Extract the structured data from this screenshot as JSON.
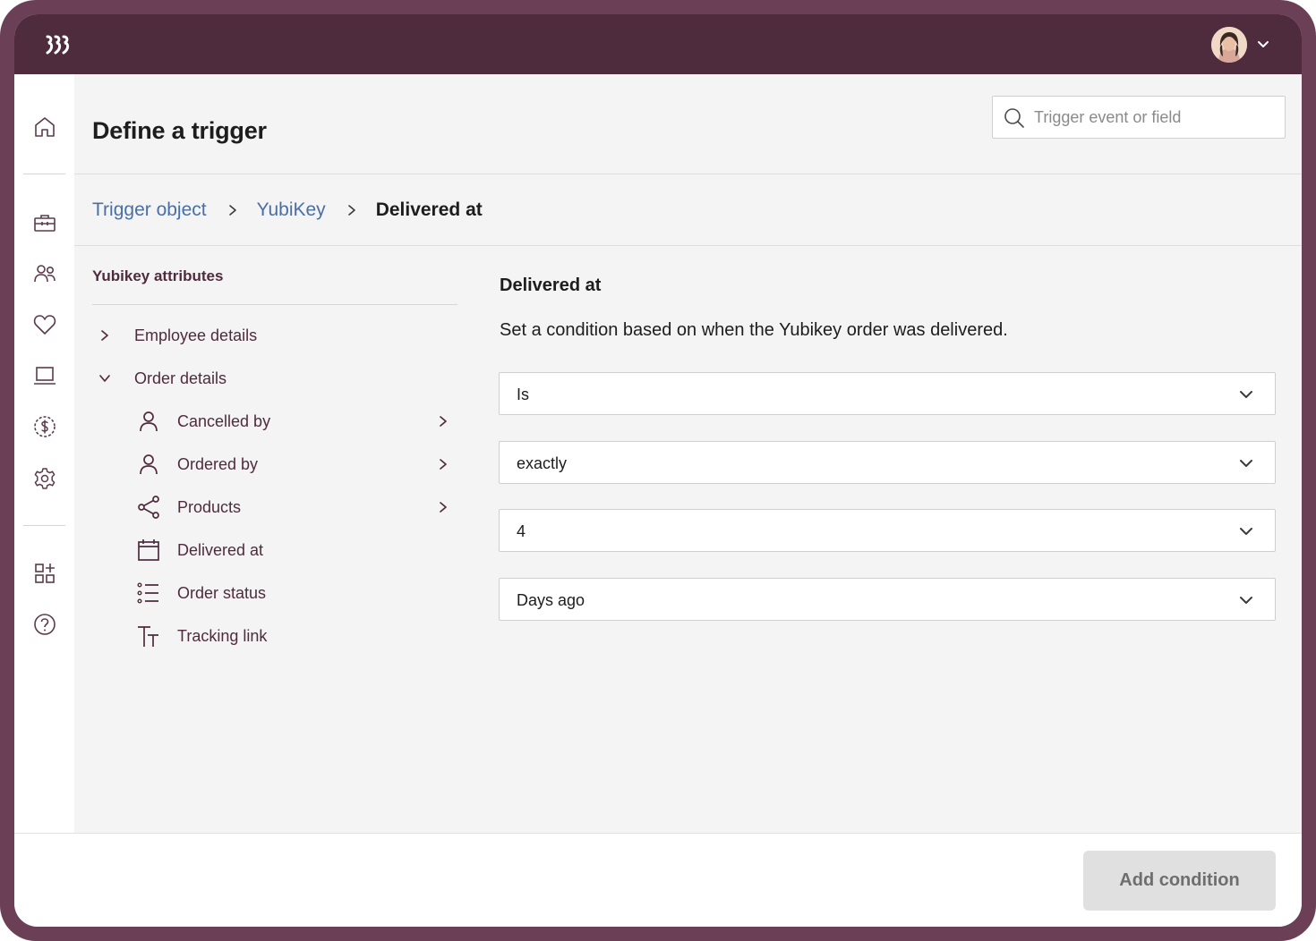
{
  "header": {
    "title": "Define a trigger",
    "search_placeholder": "Trigger event or field"
  },
  "breadcrumb": {
    "items": [
      "Trigger object",
      "YubiKey"
    ],
    "current": "Delivered at"
  },
  "sidebar_icons": [
    "home-icon",
    "briefcase-icon",
    "people-icon",
    "heart-icon",
    "laptop-icon",
    "dollar-icon",
    "settings-icon",
    "apps-add-icon",
    "help-icon"
  ],
  "attributes": {
    "heading": "Yubikey attributes",
    "groups": [
      {
        "label": "Employee details",
        "expanded": false
      },
      {
        "label": "Order details",
        "expanded": true
      }
    ],
    "order_fields": [
      {
        "label": "Cancelled by",
        "icon": "person-icon",
        "has_children": true
      },
      {
        "label": "Ordered by",
        "icon": "person-icon",
        "has_children": true
      },
      {
        "label": "Products",
        "icon": "share-icon",
        "has_children": true
      },
      {
        "label": "Delivered at",
        "icon": "calendar-icon",
        "has_children": false
      },
      {
        "label": "Order status",
        "icon": "list-icon",
        "has_children": false
      },
      {
        "label": "Tracking link",
        "icon": "text-icon",
        "has_children": false
      }
    ]
  },
  "condition": {
    "title": "Delivered at",
    "description": "Set a condition based on when the Yubikey order was delivered.",
    "operator": "Is",
    "match": "exactly",
    "amount": "4",
    "unit": "Days ago"
  },
  "footer": {
    "add_button": "Add condition"
  },
  "colors": {
    "frame": "#6b3f55",
    "topbar": "#4f2b3e",
    "link": "#4a6fa5",
    "accent_text": "#4f2b3e"
  }
}
